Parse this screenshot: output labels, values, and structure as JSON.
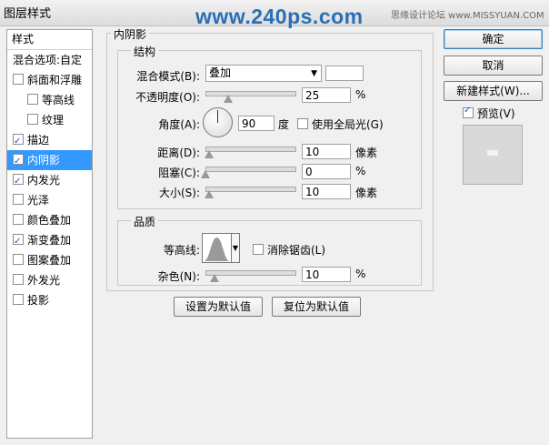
{
  "window": {
    "title": "图层样式",
    "watermark": "www.240ps.com",
    "site": "思缘设计论坛  www.MISSYUAN.COM"
  },
  "left_panel": {
    "header": "样式",
    "items": [
      {
        "label": "混合选项:自定",
        "checkbox": null,
        "checked": false,
        "selected": false,
        "indent": false
      },
      {
        "label": "斜面和浮雕",
        "checkbox": true,
        "checked": false,
        "selected": false,
        "indent": false
      },
      {
        "label": "等高线",
        "checkbox": true,
        "checked": false,
        "selected": false,
        "indent": true
      },
      {
        "label": "纹理",
        "checkbox": true,
        "checked": false,
        "selected": false,
        "indent": true
      },
      {
        "label": "描边",
        "checkbox": true,
        "checked": true,
        "selected": false,
        "indent": false
      },
      {
        "label": "内阴影",
        "checkbox": true,
        "checked": true,
        "selected": true,
        "indent": false
      },
      {
        "label": "内发光",
        "checkbox": true,
        "checked": true,
        "selected": false,
        "indent": false
      },
      {
        "label": "光泽",
        "checkbox": true,
        "checked": false,
        "selected": false,
        "indent": false
      },
      {
        "label": "颜色叠加",
        "checkbox": true,
        "checked": false,
        "selected": false,
        "indent": false
      },
      {
        "label": "渐变叠加",
        "checkbox": true,
        "checked": true,
        "selected": false,
        "indent": false
      },
      {
        "label": "图案叠加",
        "checkbox": true,
        "checked": false,
        "selected": false,
        "indent": false
      },
      {
        "label": "外发光",
        "checkbox": true,
        "checked": false,
        "selected": false,
        "indent": false
      },
      {
        "label": "投影",
        "checkbox": true,
        "checked": false,
        "selected": false,
        "indent": false
      }
    ]
  },
  "inner_shadow": {
    "title": "内阴影",
    "structure": {
      "title": "结构",
      "blend_mode": {
        "label": "混合模式(B):",
        "value": "叠加",
        "color": "#ffffff"
      },
      "opacity": {
        "label": "不透明度(O):",
        "value": "25",
        "unit": "%",
        "level": 0.25
      },
      "angle": {
        "label": "角度(A):",
        "value": "90",
        "unit": "度",
        "global_light_label": "使用全局光(G)",
        "global_light": false
      },
      "distance": {
        "label": "距离(D):",
        "value": "10",
        "unit": "像素",
        "level": 0.04
      },
      "choke": {
        "label": "阻塞(C):",
        "value": "0",
        "unit": "%",
        "level": 0.0
      },
      "size": {
        "label": "大小(S):",
        "value": "10",
        "unit": "像素",
        "level": 0.04
      }
    },
    "quality": {
      "title": "品质",
      "contour_label": "等高线:",
      "anti_alias_label": "消除锯齿(L)",
      "anti_alias": false,
      "noise": {
        "label": "杂色(N):",
        "value": "10",
        "unit": "%",
        "level": 0.1
      }
    },
    "make_default": "设置为默认值",
    "reset_default": "复位为默认值"
  },
  "buttons": {
    "ok": "确定",
    "cancel": "取消",
    "new_style": "新建样式(W)...",
    "preview_label": "预览(V)",
    "preview": true
  }
}
